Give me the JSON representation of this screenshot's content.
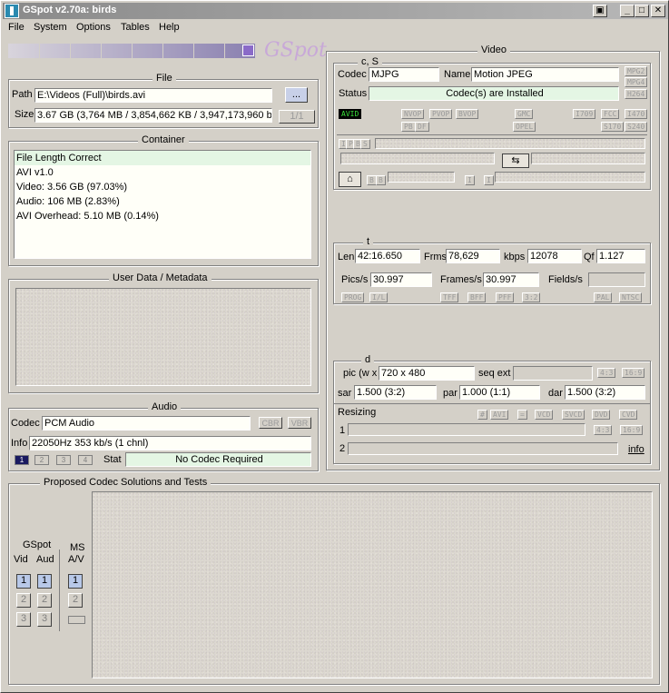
{
  "window": {
    "title": "GSpot v2.70a: birds",
    "controls": [
      "▣",
      "_",
      "□",
      "✕"
    ]
  },
  "menu": [
    "File",
    "System",
    "Options",
    "Tables",
    "Help"
  ],
  "logo_text": "GSpot",
  "file_group": {
    "title": "File",
    "path_label": "Path",
    "path_value": "E:\\Videos (Full)\\birds.avi",
    "browse_label": "...",
    "size_label": "Size",
    "size_value": "3.67 GB (3,764 MB / 3,854,662 KB / 3,947,173,960 by",
    "page_indicator": "1/1"
  },
  "container_group": {
    "title": "Container",
    "items": [
      "File Length Correct",
      "AVI v1.0",
      "Video: 3.56 GB (97.03%)",
      "Audio: 106 MB (2.83%)",
      "AVI Overhead: 5.10 MB (0.14%)"
    ]
  },
  "userdata_group": {
    "title": "User Data / Metadata"
  },
  "audio_group": {
    "title": "Audio",
    "codec_label": "Codec",
    "codec_value": "PCM Audio",
    "cbr_label": "CBR",
    "vbr_label": "VBR",
    "info_label": "Info",
    "info_value": "22050Hz  353 kb/s (1 chnl)",
    "tabs": [
      "1",
      "2",
      "3",
      "4"
    ],
    "stat_label": "Stat",
    "stat_value": "No Codec Required"
  },
  "video_group": {
    "title": "Video",
    "cs_title": "c, S",
    "codec_label": "Codec",
    "codec_value": "MJPG",
    "name_label": "Name",
    "name_value": "Motion JPEG",
    "status_label": "Status",
    "status_value": "Codec(s) are Installed",
    "right_tags": [
      "MPG2",
      "MPG4",
      "H264"
    ],
    "flags": {
      "avid": "AVID",
      "nvop": "NVOP",
      "pvop": "PVOP",
      "bvop": "BVOP",
      "pb": "PB",
      "df": "DF",
      "gmc": "GMC",
      "opel": "OPEL",
      "i709": "I709",
      "fcc": "FCC",
      "i470": "I470",
      "s170": "S170",
      "s240": "S240"
    },
    "frame_btns": [
      "I",
      "P",
      "B",
      "S"
    ],
    "frame_btns2": [
      "B",
      "B"
    ],
    "frame_btns3": [
      "I",
      "I"
    ],
    "t_title": "t",
    "len_label": "Len",
    "len_value": "42:16.650",
    "frms_label": "Frms",
    "frms_value": "78,629",
    "kbps_label": "kbps",
    "kbps_value": "12078",
    "qf_label": "Qf",
    "qf_value": "1.127",
    "pics_label": "Pics/s",
    "pics_value": "30.997",
    "frames_label": "Frames/s",
    "frames_value": "30.997",
    "fields_label": "Fields/s",
    "fields_value": "",
    "row_tags": [
      "PROG",
      "I/L",
      "TFF",
      "BFF",
      "PFF",
      "3:2",
      "PAL",
      "NTSC"
    ],
    "d_title": "d",
    "pic_label": "pic (w x",
    "pic_value": "720 x 480",
    "seqext_label": "seq ext",
    "ar_tags": [
      "4:3",
      "16:9"
    ],
    "sar_label": "sar",
    "sar_value": "1.500 (3:2)",
    "par_label": "par",
    "par_value": "1.000 (1:1)",
    "dar_label": "dar",
    "dar_value": "1.500 (3:2)",
    "resizing_label": "Resizing",
    "resize_btns": [
      "#",
      "AVI",
      "=",
      "VCD",
      "SVCD",
      "DVD",
      "CVD"
    ],
    "resize_ar": [
      "4:3",
      "16:9"
    ],
    "row1_label": "1",
    "row2_label": "2",
    "info_link": "info"
  },
  "proposed": {
    "title": "Proposed Codec Solutions and Tests",
    "gspot_label": "GSpot",
    "vid_label": "Vid",
    "aud_label": "Aud",
    "ms_label": "MS",
    "av_label": "A/V",
    "nums": [
      "1",
      "2",
      "3"
    ],
    "ms_nums": [
      "1",
      "2"
    ]
  }
}
